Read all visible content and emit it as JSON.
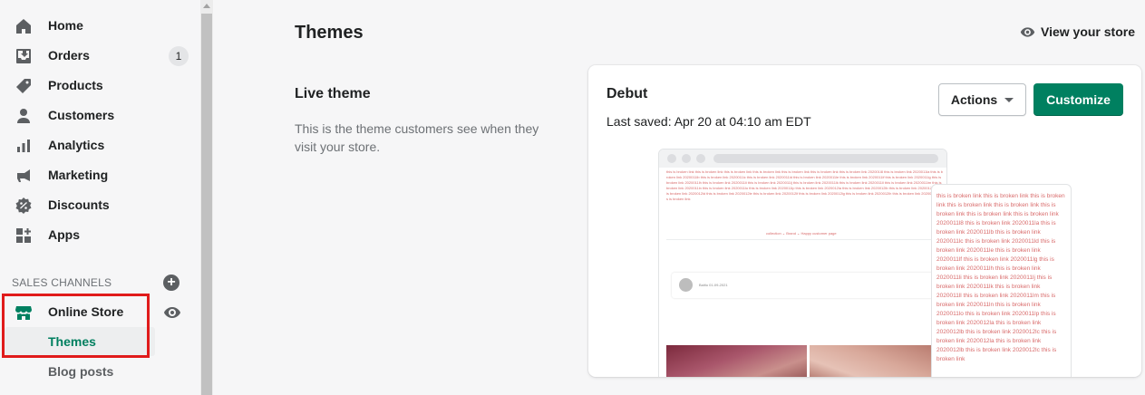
{
  "sidebar": {
    "items": [
      {
        "label": "Home",
        "icon": "home-icon"
      },
      {
        "label": "Orders",
        "icon": "orders-icon",
        "badge": "1"
      },
      {
        "label": "Products",
        "icon": "tag-icon"
      },
      {
        "label": "Customers",
        "icon": "person-icon"
      },
      {
        "label": "Analytics",
        "icon": "bar-chart-icon"
      },
      {
        "label": "Marketing",
        "icon": "megaphone-icon"
      },
      {
        "label": "Discounts",
        "icon": "discount-icon"
      },
      {
        "label": "Apps",
        "icon": "apps-icon"
      }
    ],
    "sales_channels_title": "SALES CHANNELS",
    "online_store": "Online Store",
    "sub_items": {
      "themes": "Themes",
      "blog_posts": "Blog posts"
    }
  },
  "main": {
    "title": "Themes",
    "view_store": "View your store",
    "live_theme": {
      "heading": "Live theme",
      "description": "This is the theme customers see when they visit your store."
    }
  },
  "theme_card": {
    "name": "Debut",
    "last_saved": "Last saved: Apr 20 at 04:10 am EDT",
    "actions_label": "Actions",
    "customize_label": "Customize",
    "preview": {
      "desktop_text": "this is broken link this is broken link this is broken link this is broken link this is broken link this is broken link this is broken link 202001l8 this is broken link 2020011la this is broken link 2020011lb this is broken link 2020011lc this is broken link 2020011ld this is broken link 2020011le this is broken link 2020011lf this is broken link 2020011lg this is broken link 2020011lh this is broken link 2020011li this is broken link 2020011lj this is broken link 2020011lk this is broken link 2020011ll this is broken link 2020011lm this is broken link 2020011ln this is broken link 2020011lo this is broken link 2020011lp this is broken link 2020012la this is broken link 2020012lb this is broken link 2020012lc this is broken link 2020012ld this is broken link 2020012le this is broken link 2020012lf this is broken link 2020012lg this is broken link 2020012lh this is broken link 2020012li this is broken link",
      "nav_text": "collection ⌄   Brand ⌄   Happy customer page",
      "nav_icons": "⌕  ▯",
      "review_meta": "Baitlu   01-09-2021",
      "mobile_text": "this is broken link this is broken link this is broken link this is broken link this is broken link this is broken link this is broken link this is broken link 2020011l8 this is broken link 2020011la this is broken link 2020011lb this is broken link 2020011lc this is broken link 2020011ld this is broken link 2020011le this is broken link 2020011lf this is broken link 2020011lg this is broken link 2020011lh this is broken link 2020011li this is broken link 2020011lj this is broken link 2020011lk this is broken link 2020011ll this is broken link 2020011lm this is broken link 2020011ln this is broken link 2020011lo this is broken link 2020011lp this is broken link 2020012la this is broken link 2020012lb this is broken link 2020012lc this is broken link 2020012la this is broken link 2020012lb this is broken link 2020012lc this is broken link"
    }
  },
  "colors": {
    "accent_green": "#008060",
    "active_text": "#007f5f",
    "highlight_red": "#e01b1b",
    "broken_link_text": "#d86a6a"
  }
}
